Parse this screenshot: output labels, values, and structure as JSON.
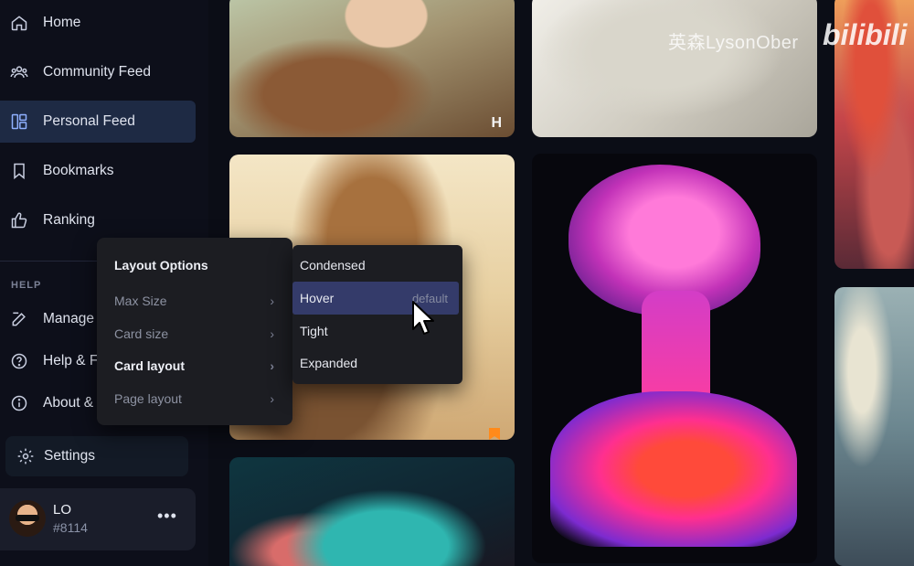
{
  "sidebar": {
    "items": [
      {
        "label": "Home",
        "icon": "home-icon"
      },
      {
        "label": "Community Feed",
        "icon": "users-icon"
      },
      {
        "label": "Personal Feed",
        "icon": "layout-icon",
        "active": true
      },
      {
        "label": "Bookmarks",
        "icon": "bookmark-icon"
      },
      {
        "label": "Ranking",
        "icon": "thumbs-up-icon"
      }
    ],
    "help_section_label": "HELP",
    "help_items": [
      {
        "label": "Manage",
        "icon": "edit-icon"
      },
      {
        "label": "Help & F",
        "icon": "help-circle-icon"
      },
      {
        "label": "About &",
        "icon": "info-icon"
      }
    ],
    "settings_label": "Settings",
    "user": {
      "name": "LO",
      "tag": "#8114",
      "more": "•••"
    }
  },
  "layout_menu": {
    "title": "Layout Options",
    "items": [
      {
        "label": "Max Size",
        "active": false
      },
      {
        "label": "Card size",
        "active": false
      },
      {
        "label": "Card layout",
        "active": true
      },
      {
        "label": "Page layout",
        "active": false
      }
    ]
  },
  "card_layout_submenu": {
    "items": [
      {
        "label": "Condensed",
        "note": ""
      },
      {
        "label": "Hover",
        "note": "default",
        "selected": true
      },
      {
        "label": "Tight",
        "note": ""
      },
      {
        "label": "Expanded",
        "note": ""
      }
    ]
  },
  "watermark": {
    "text": "英森LysonOber",
    "logo": "bilibili"
  },
  "tiles": {
    "badge_letter": "H"
  },
  "colors": {
    "accent": "#1e2a44",
    "selected": "#343b6a",
    "bookmark": "#ff8a1a"
  }
}
